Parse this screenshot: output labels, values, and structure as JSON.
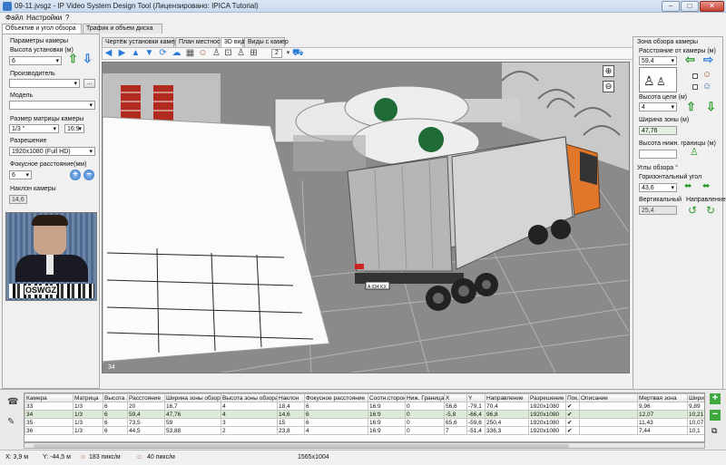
{
  "window": {
    "title": "09-11.jvsgz - IP Video System Design Tool (Лицензировано: IPICA Tutorial)",
    "minimize": "–",
    "maximize": "□",
    "close": "✕"
  },
  "menu": [
    "Файл",
    "Настройки",
    "?"
  ],
  "left_tabs": [
    "Объектив и угол обзора",
    "Трафик и объем диска"
  ],
  "camera_params": {
    "header": "Параметры камеры",
    "height_label": "Высота установки (м)",
    "height_value": "6",
    "maker_label": "Производитель",
    "maker_value": "",
    "maker_btn": "...",
    "model_label": "Модель",
    "model_value": "",
    "sensor_label": "Размер матрицы камеры",
    "sensor_value": "1/3 \"",
    "aspect_value": "16:9",
    "resolution_label": "Разрешение",
    "resolution_value": "1920x1080 (Full HD)",
    "focal_label": "Фокусное расстояние(мм)",
    "focal_value": "6",
    "tilt_label": "Наклон камеры",
    "tilt_value": "14,6",
    "test_pattern": "OSWGZ"
  },
  "view_tabs": [
    "Чертёж установки камеры",
    "План местности",
    "3D вид",
    "Виды с камер"
  ],
  "toolbar": {
    "count_value": "2"
  },
  "viewport": {
    "camera_label": "34",
    "trailer_plate": "A 034 KX"
  },
  "zone": {
    "header": "Зона обзора камеры",
    "distance_label": "Расстояние от камеры (м)",
    "distance_value": "59,4",
    "target_height_label": "Высота цели (м)",
    "target_height_value": "4",
    "width_label": "Ширина зоны (м)",
    "width_value": "47,76",
    "lower_label": "Высота нижн. границы (м)",
    "lower_value": ""
  },
  "angles": {
    "header": "Углы обзора °",
    "horizontal_label": "Горизонтальный угол",
    "horizontal_value": "43,6",
    "vertical_label": "Вертикальный",
    "vertical_value": "25,4",
    "direction_label": "Направление"
  },
  "table": {
    "columns": [
      "Камера",
      "Матрица",
      "Высота ...",
      "Расстояние",
      "Ширина зоны обзора",
      "Высота зоны обзора",
      "Наклон",
      "Фокусное расстояние",
      "Соотн.сторон",
      "Ниж. Граница",
      "X",
      "Y",
      "Направление",
      "Разрешение",
      "Пок...",
      "Описание",
      "Мертвая зона",
      "Ширина"
    ],
    "rows": [
      [
        "33",
        "1/3",
        "6",
        "20",
        "16,7",
        "4",
        "18,4",
        "6",
        "16:9",
        "0",
        "56,6",
        "-79,1",
        "70,4",
        "1920x1080",
        "✔",
        "",
        "9,96",
        "9,89"
      ],
      [
        "34",
        "1/3",
        "6",
        "59,4",
        "47,76",
        "4",
        "14,6",
        "6",
        "16:9",
        "0",
        "-5,8",
        "-66,4",
        "96,8",
        "1920x1080",
        "✔",
        "",
        "12,07",
        "10,21"
      ],
      [
        "35",
        "1/3",
        "6",
        "73,5",
        "59",
        "3",
        "15",
        "6",
        "16:9",
        "0",
        "65,6",
        "-59,6",
        "250,4",
        "1920x1080",
        "✔",
        "",
        "11,43",
        "10,07"
      ],
      [
        "36",
        "1/3",
        "6",
        "44,5",
        "53,88",
        "2",
        "23,8",
        "4",
        "16:9",
        "0",
        "7",
        "-51,4",
        "336,3",
        "1920x1080",
        "✔",
        "",
        "7,44",
        "10,1"
      ]
    ]
  },
  "status": {
    "x": "X: 3,9 м",
    "y": "Y: -44,5 м",
    "px1": "183 пикс/м",
    "px2": "40 пикс/м",
    "res": "1565x1004"
  },
  "colors": {
    "accent": "#2a7bd6",
    "green": "#2c9a2c",
    "orange": "#e0772a",
    "grid": "#d8d8d8",
    "selected_row": "#dcebd5"
  }
}
